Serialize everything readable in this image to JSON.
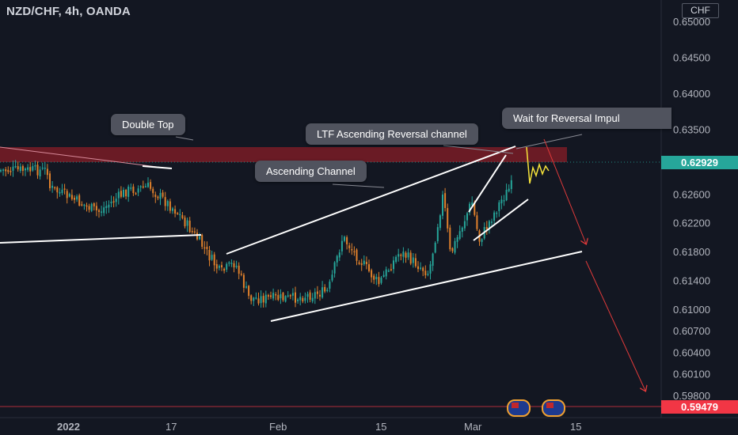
{
  "header": {
    "symbol_title": "NZD/CHF, 4h, OANDA"
  },
  "axis": {
    "currency": "CHF",
    "price_labels": [
      "0.65000",
      "0.64500",
      "0.64000",
      "0.63500",
      "0.62600",
      "0.62200",
      "0.61800",
      "0.61400",
      "0.61000",
      "0.60700",
      "0.60400",
      "0.60100",
      "0.59800"
    ],
    "price_values": [
      0.65,
      0.645,
      0.64,
      0.635,
      0.626,
      0.622,
      0.618,
      0.614,
      0.61,
      0.607,
      0.604,
      0.601,
      0.598
    ],
    "date_labels": [
      "2022",
      "17",
      "Feb",
      "15",
      "Mar",
      "15"
    ]
  },
  "price_tags": {
    "current": "0.62929",
    "target": "0.59479",
    "current_color": "#26a69a",
    "target_color": "#f23645"
  },
  "annotations": {
    "double_top": "Double Top",
    "ascending_channel": "Ascending Channel",
    "ltf_channel": "LTF Ascending Reversal channel",
    "wait_reversal": "Wait for Reversal Impul"
  },
  "colors": {
    "background": "#131722",
    "resistance_zone": "#7a1c26",
    "up_candle": "#26a69a",
    "down_candle": "#e0812c",
    "trendline": "#ffffff",
    "projection": "#e03a3a",
    "zigzag": "#f5e23a"
  },
  "icons": {
    "flags": [
      "nz-flag-icon",
      "nz-flag-icon"
    ]
  },
  "chart_data": {
    "type": "candlestick",
    "title": "NZD/CHF, 4h, OANDA",
    "timeframe": "4h",
    "y_unit": "CHF",
    "ylim": [
      0.5955,
      0.6525
    ],
    "current_price": 0.62929,
    "target_price": 0.59479,
    "resistance_zone": [
      0.6285,
      0.6306
    ],
    "x_ticks": [
      "2022",
      "17",
      "Feb",
      "15",
      "Mar",
      "15"
    ],
    "price_path": [
      {
        "date": "2021-12-31",
        "price": 0.627
      },
      {
        "date": "2022-01-07",
        "price": 0.6235
      },
      {
        "date": "2022-01-11",
        "price": 0.6265
      },
      {
        "date": "2022-01-14",
        "price": 0.627
      },
      {
        "date": "2022-01-18",
        "price": 0.6235
      },
      {
        "date": "2022-01-21",
        "price": 0.6195
      },
      {
        "date": "2022-01-24",
        "price": 0.615
      },
      {
        "date": "2022-01-26",
        "price": 0.6165
      },
      {
        "date": "2022-01-28",
        "price": 0.6115
      },
      {
        "date": "2022-02-03",
        "price": 0.6115
      },
      {
        "date": "2022-02-08",
        "price": 0.6125
      },
      {
        "date": "2022-02-10",
        "price": 0.62
      },
      {
        "date": "2022-02-15",
        "price": 0.6135
      },
      {
        "date": "2022-02-18",
        "price": 0.618
      },
      {
        "date": "2022-02-22",
        "price": 0.615
      },
      {
        "date": "2022-02-24",
        "price": 0.626
      },
      {
        "date": "2022-02-25",
        "price": 0.6175
      },
      {
        "date": "2022-02-28",
        "price": 0.625
      },
      {
        "date": "2022-03-01",
        "price": 0.6195
      },
      {
        "date": "2022-03-04",
        "price": 0.625
      },
      {
        "date": "2022-03-07",
        "price": 0.6293
      }
    ]
  }
}
